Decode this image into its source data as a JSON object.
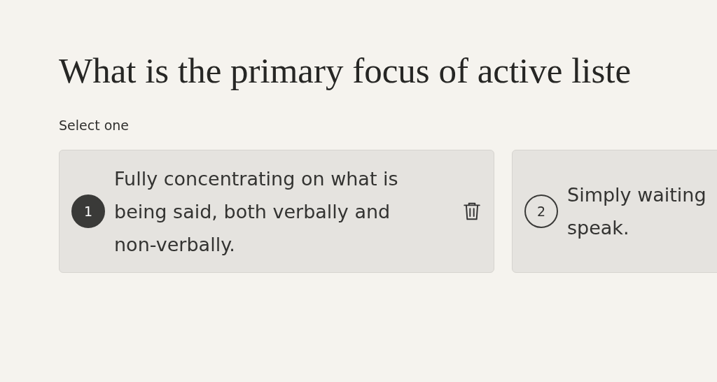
{
  "question": {
    "title": "What is the primary focus of active liste",
    "instruction": "Select one"
  },
  "options": [
    {
      "number": "1",
      "lines": [
        "Fully concentrating on what is",
        "being said, both verbally and",
        "non-verbally."
      ],
      "selected": true
    },
    {
      "number": "2",
      "lines": [
        "Simply waiting",
        "speak."
      ],
      "selected": false
    }
  ]
}
